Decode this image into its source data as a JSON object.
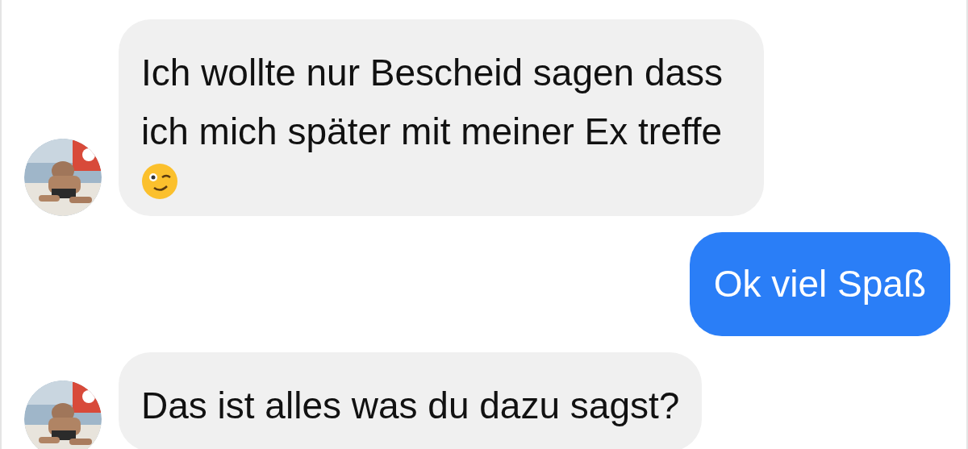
{
  "messages": [
    {
      "kind": "received",
      "text": "Ich wollte nur Bescheid sagen dass ich mich später mit meiner Ex treffe",
      "has_emoji": true,
      "avatar": true
    },
    {
      "kind": "sent",
      "text": "Ok viel Spaß",
      "has_emoji": false,
      "avatar": false
    },
    {
      "kind": "received",
      "text": "Das ist alles was du dazu sagst?",
      "has_emoji": false,
      "avatar": true
    }
  ]
}
